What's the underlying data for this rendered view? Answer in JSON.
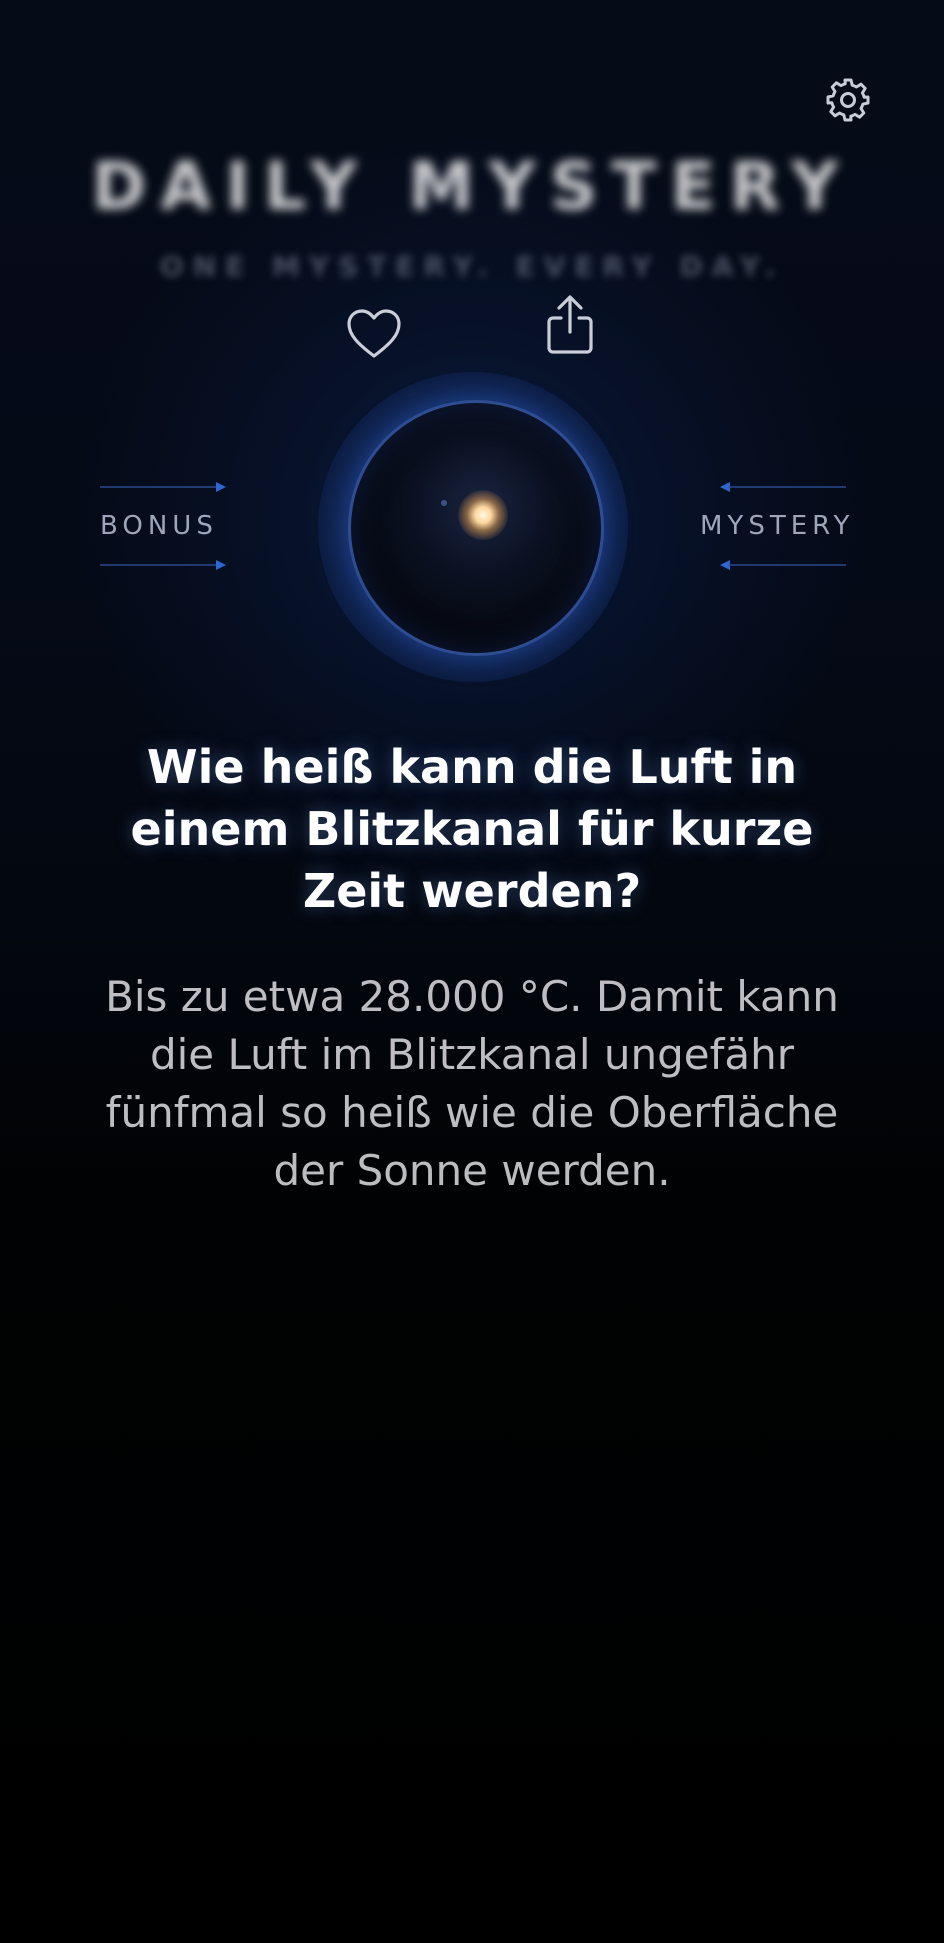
{
  "header": {
    "title": "DAILY MYSTERY",
    "tagline": "ONE MYSTERY. EVERY DAY.",
    "settings_icon": "gear-icon"
  },
  "actions": {
    "favorite_icon": "heart-icon",
    "share_icon": "share-icon"
  },
  "orb": {
    "left_label": "BONUS",
    "right_label": "MYSTERY",
    "accent": "#3c64be",
    "glow": "#ffd9a0"
  },
  "content": {
    "question": "Wie heiß kann die Luft in einem Blitzkanal für kurze Zeit werden?",
    "answer": "Bis zu etwa 28.000 °C. Damit kann die Luft im Blitzkanal ungefähr fünfmal so heiß wie die Oberfläche der Sonne werden."
  }
}
